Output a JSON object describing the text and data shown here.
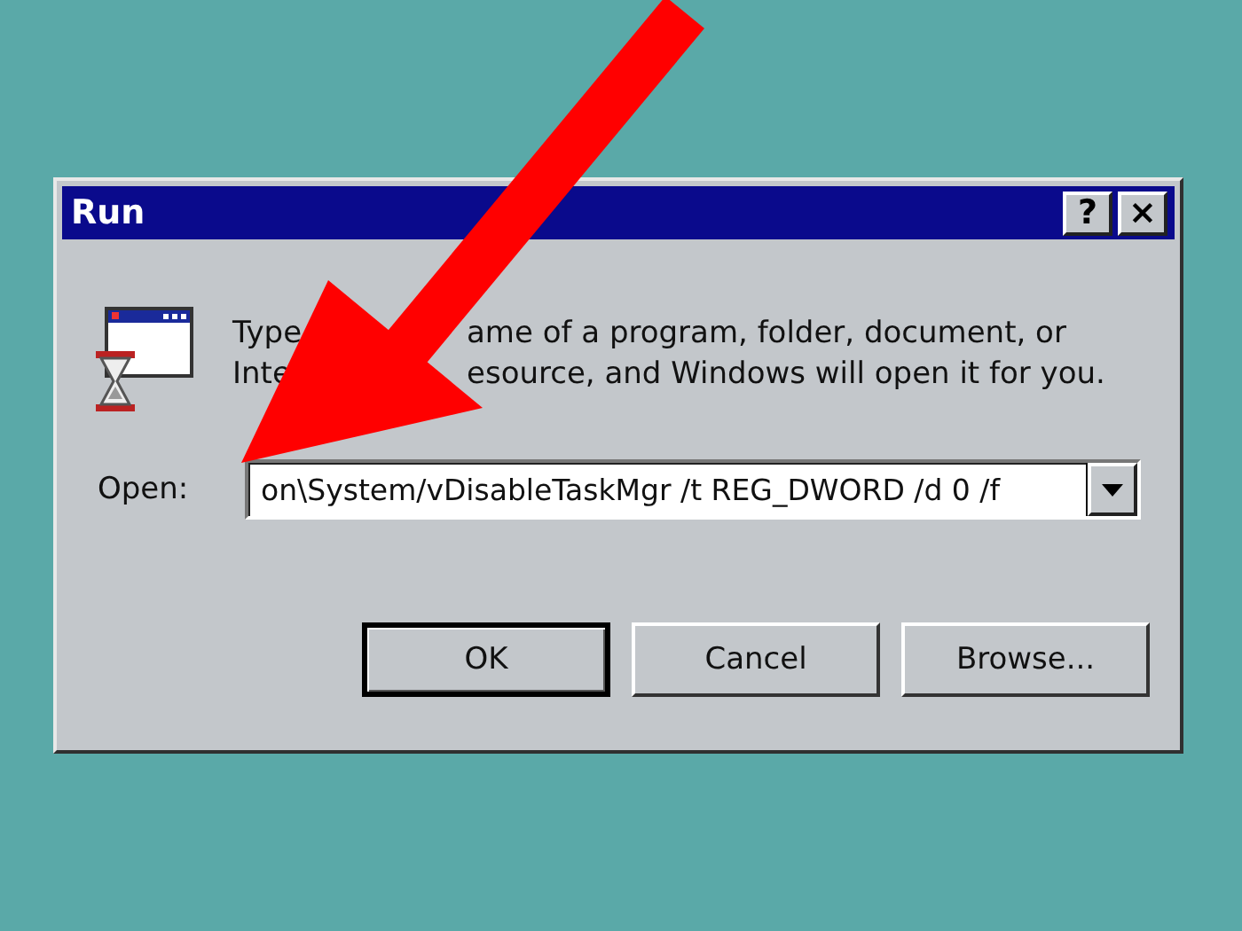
{
  "window": {
    "title": "Run",
    "title_buttons": [
      "?",
      "×"
    ]
  },
  "description_lines": [
    {
      "fragments": [
        "Type",
        "ame of a program, folder, document, or"
      ]
    },
    {
      "fragments": [
        "Inte",
        "esource, and Windows will open it for you."
      ]
    }
  ],
  "open_field": {
    "label": "Open:",
    "value": "on\\System/vDisableTaskMgr /t REG_DWORD /d 0 /f"
  },
  "buttons": [
    {
      "label": "OK",
      "default": true
    },
    {
      "label": "Cancel",
      "default": false
    },
    {
      "label": "Browse...",
      "default": false
    }
  ]
}
